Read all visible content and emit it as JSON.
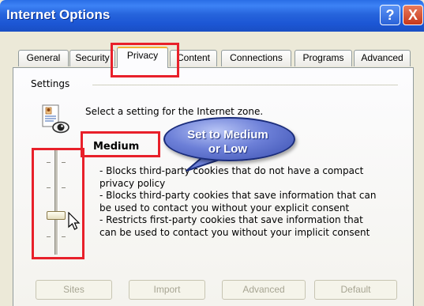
{
  "window": {
    "title": "Internet Options",
    "help_label": "?",
    "close_label": "X"
  },
  "tabs": [
    {
      "label": "General"
    },
    {
      "label": "Security"
    },
    {
      "label": "Privacy",
      "active": true
    },
    {
      "label": "Content"
    },
    {
      "label": "Connections"
    },
    {
      "label": "Programs"
    },
    {
      "label": "Advanced"
    }
  ],
  "settings": {
    "group_label": "Settings",
    "instruction": "Select a setting for the Internet zone.",
    "level_name": "Medium",
    "description_lines": [
      "- Blocks third-party cookies that do not have a compact",
      "privacy policy",
      "- Blocks third-party cookies that save information that can",
      "be used to contact you without your explicit consent",
      "- Restricts first-party cookies that save information that",
      "can be used to contact you without your implicit consent"
    ]
  },
  "callout": {
    "line1": "Set to Medium",
    "line2": "or Low"
  },
  "buttons": {
    "sites": "Sites",
    "import": "Import",
    "advanced": "Advanced",
    "default": "Default"
  },
  "colors": {
    "titlebar": "#2664dc",
    "highlight": "#e8202a",
    "callout": "#6d80d8",
    "active_tab_accent": "#f4b133"
  },
  "icons": {
    "zone": "privacy-document-eye-icon",
    "cursor": "mouse-pointer-icon"
  }
}
